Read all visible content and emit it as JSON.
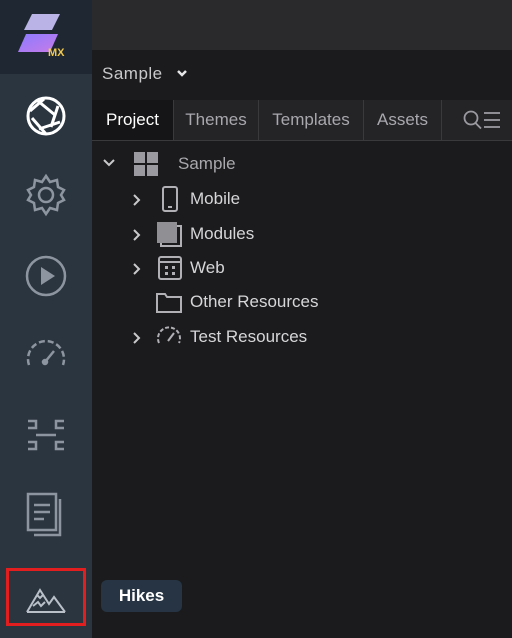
{
  "project": {
    "name": "Sample"
  },
  "tabs": [
    "Project",
    "Themes",
    "Templates",
    "Assets"
  ],
  "tree": {
    "root": "Sample",
    "items": [
      "Mobile",
      "Modules",
      "Web",
      "Other Resources",
      "Test Resources"
    ]
  },
  "logo": {
    "text": "MX"
  },
  "tooltip": {
    "text": "Hikes"
  },
  "colors": {
    "rail": "#2b3540",
    "highlight": "#e21e1e",
    "panel": "#1b1b1d"
  },
  "icons": [
    "logo-icon",
    "aperture-icon",
    "gear-icon",
    "play-icon",
    "speedometer-icon",
    "bracket-icon",
    "document-icon",
    "mountain-icon",
    "search-icon",
    "list-icon",
    "grid-icon",
    "phone-icon",
    "module-icon",
    "web-icon",
    "folder-icon",
    "test-icon"
  ]
}
